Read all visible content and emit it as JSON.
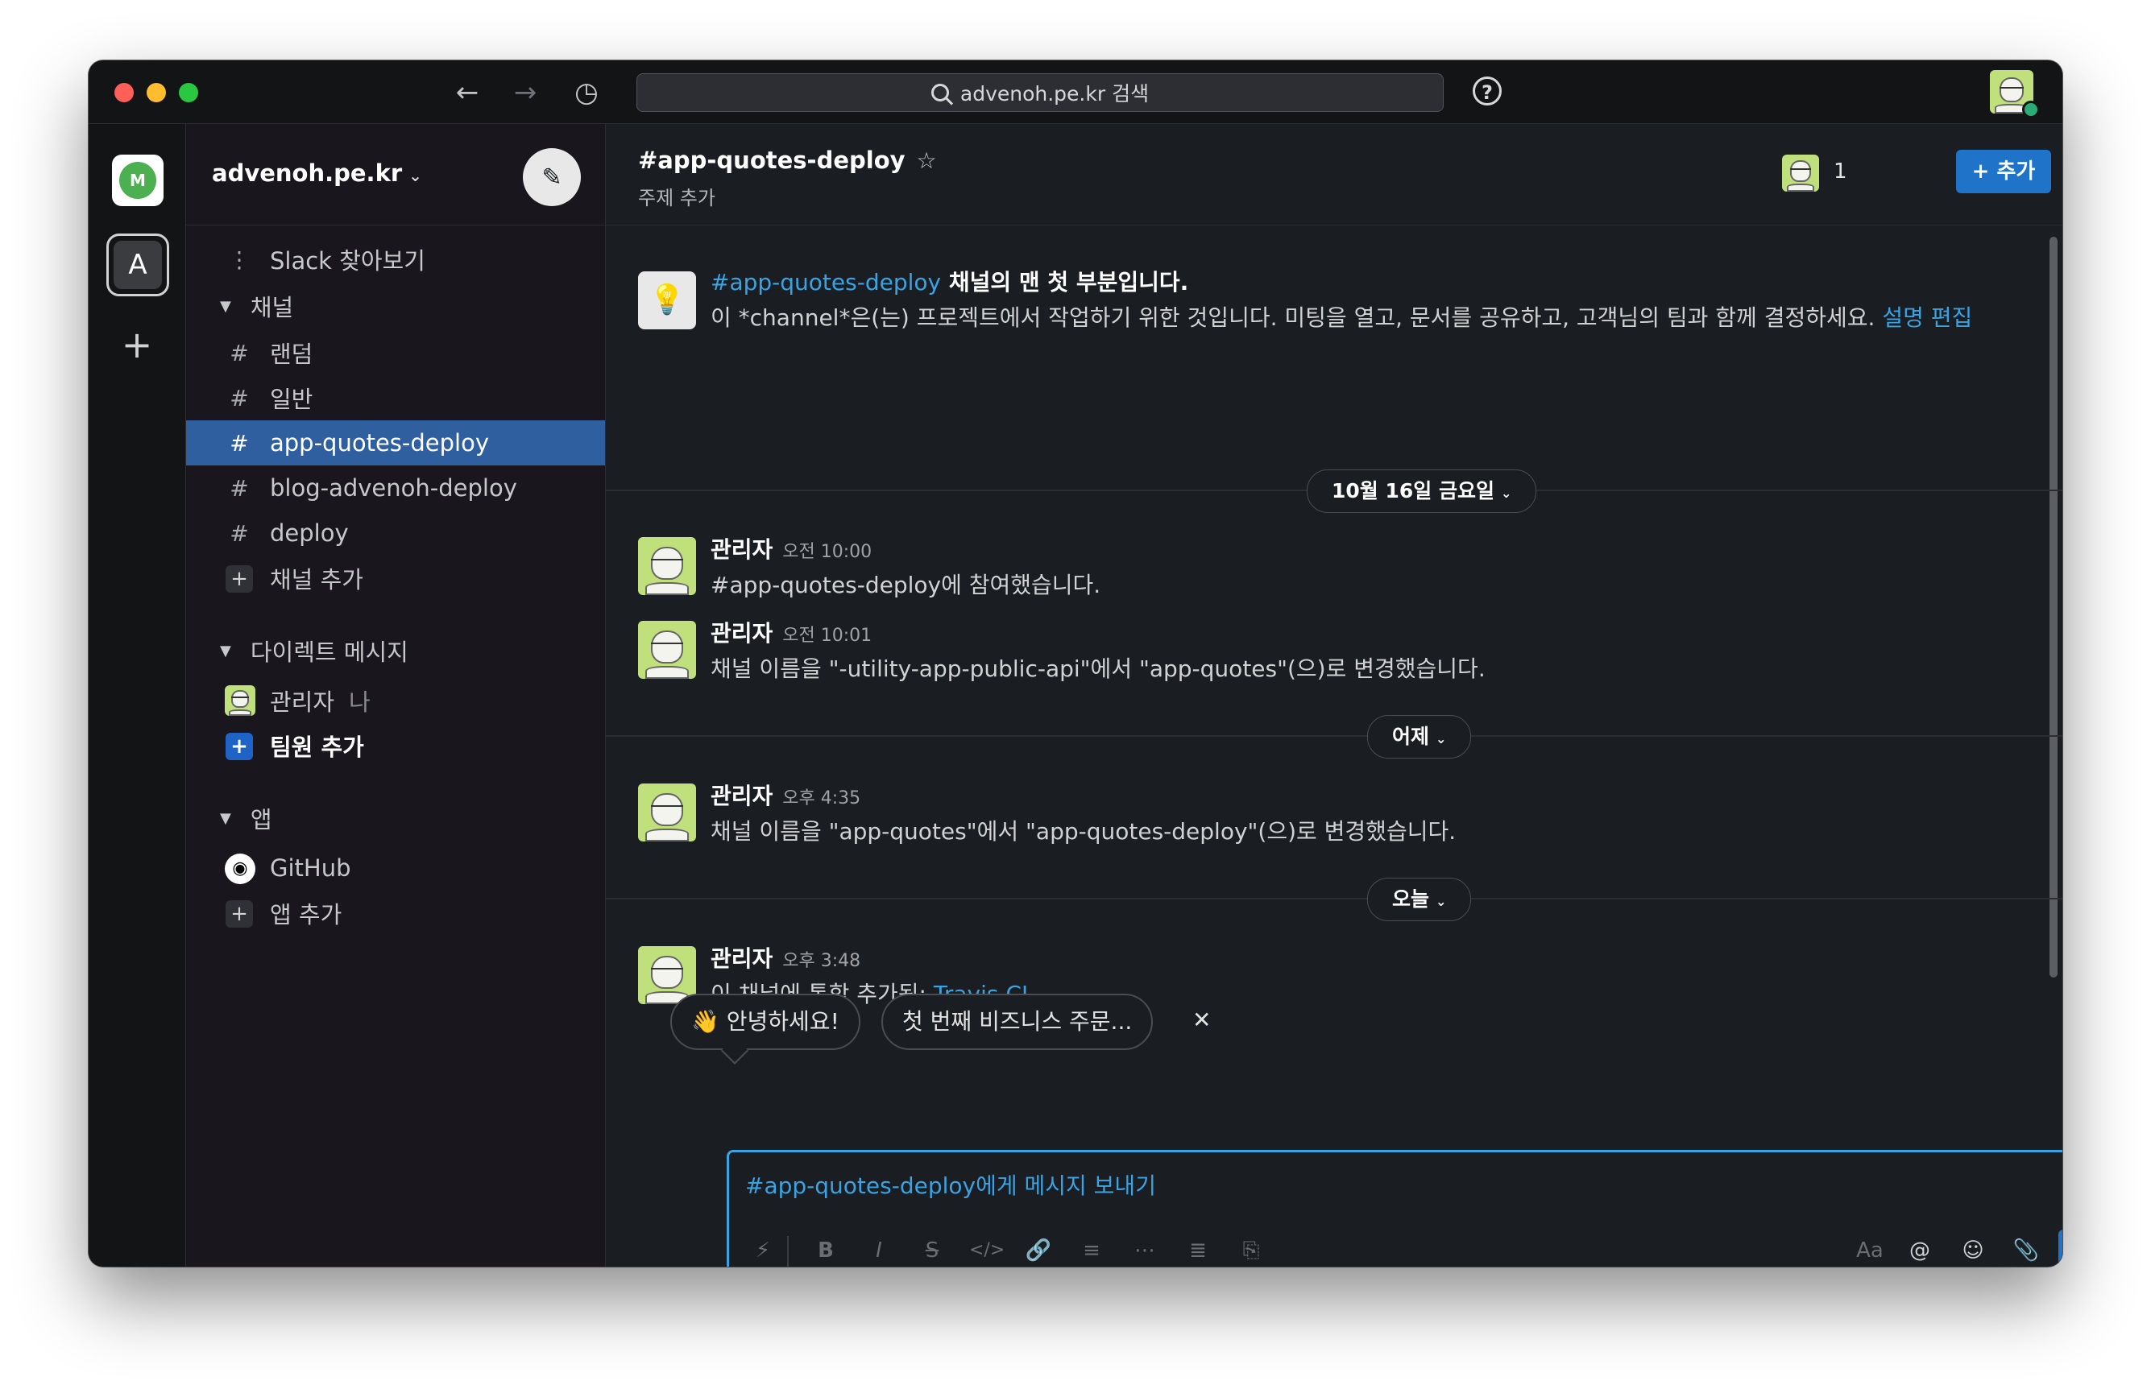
{
  "titlebar": {
    "search_text": "advenoh.pe.kr 검색",
    "back_icon": "arrow-left-icon",
    "forward_icon": "arrow-right-icon",
    "history_icon": "clock-icon",
    "help_icon": "question-icon"
  },
  "workspace": {
    "name": "advenoh.pe.kr",
    "rail_letter": "A"
  },
  "sidebar": {
    "browse": "Slack 찾아보기",
    "channels_section": "채널",
    "channels": [
      {
        "label": "랜덤"
      },
      {
        "label": "일반"
      },
      {
        "label": "app-quotes-deploy",
        "active": true
      },
      {
        "label": "blog-advenoh-deploy"
      },
      {
        "label": "deploy"
      }
    ],
    "add_channel": "채널 추가",
    "dm_section": "다이렉트 메시지",
    "dm_user": "관리자",
    "dm_me": "나",
    "add_member": "팀원 추가",
    "apps_section": "앱",
    "app_github": "GitHub",
    "add_app": "앱 추가"
  },
  "channel": {
    "title": "#app-quotes-deploy",
    "topic": "주제 추가",
    "member_count": "1",
    "add_button": "+ 추가"
  },
  "intro": {
    "channel_link": "#app-quotes-deploy",
    "line1_rest": " 채널의 맨 첫 부분입니다.",
    "line2": "이 *channel*은(는) 프로젝트에서 작업하기 위한 것입니다. 미팅을 열고, 문서를 공유하고, 고객님의 팀과 함께 결정하세요.",
    "edit_link": "설명 편집"
  },
  "dates": {
    "first": "10월 16일 금요일",
    "second": "어제",
    "third": "오늘"
  },
  "messages": [
    {
      "name": "관리자",
      "time": "오전 10:00",
      "text": "#app-quotes-deploy에 참여했습니다."
    },
    {
      "name": "관리자",
      "time": "오전 10:01",
      "text": "채널 이름을 \"-utility-app-public-api\"에서 \"app-quotes\"(으)로 변경했습니다."
    },
    {
      "name": "관리자",
      "time": "오후 4:35",
      "text": "채널 이름을 \"app-quotes\"에서 \"app-quotes-deploy\"(으)로 변경했습니다."
    },
    {
      "name": "관리자",
      "time": "오후 3:48",
      "text": "이 채널에 통합 추가됨: ",
      "link": "Travis CI"
    }
  ],
  "suggestions": {
    "hello": "👋 안녕하세요!",
    "business": "첫 번째 비즈니스 주문..."
  },
  "composer": {
    "placeholder": "#app-quotes-deploy에게 메시지 보내기",
    "font_label": "Aa"
  },
  "colors": {
    "accent": "#3aa3e3",
    "active_channel": "#2f5f9f",
    "button": "#1f73c8",
    "background": "#1a1d21"
  }
}
